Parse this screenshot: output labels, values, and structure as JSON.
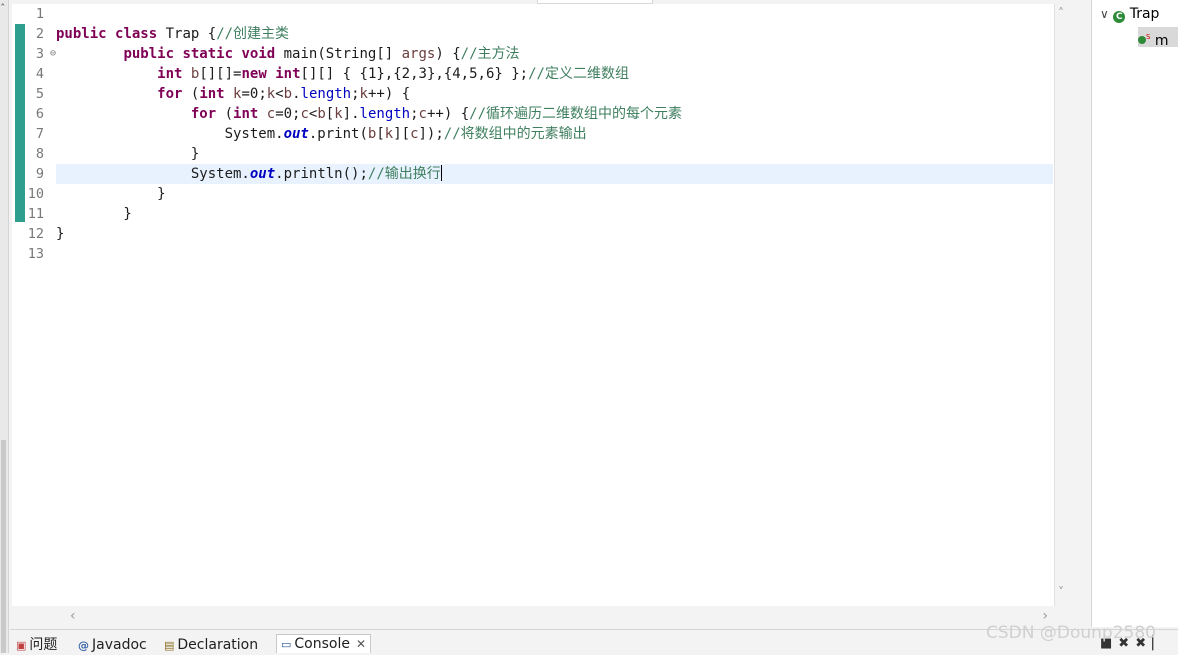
{
  "editor": {
    "lines": [
      {
        "n": "1",
        "parts": []
      },
      {
        "n": "2",
        "parts": [
          [
            "kw",
            "public"
          ],
          [
            "t",
            " "
          ],
          [
            "kw",
            "class"
          ],
          [
            "t",
            " Trap {"
          ],
          [
            "cm",
            "//创建主类"
          ]
        ]
      },
      {
        "n": "3",
        "fold": true,
        "parts": [
          [
            "t",
            "        "
          ],
          [
            "kw",
            "public"
          ],
          [
            "t",
            " "
          ],
          [
            "kw",
            "static"
          ],
          [
            "t",
            " "
          ],
          [
            "kw",
            "void"
          ],
          [
            "t",
            " main(String[] "
          ],
          [
            "lv",
            "args"
          ],
          [
            "t",
            ") {"
          ],
          [
            "cm",
            "//主方法"
          ]
        ]
      },
      {
        "n": "4",
        "parts": [
          [
            "t",
            "            "
          ],
          [
            "kw",
            "int"
          ],
          [
            "t",
            " "
          ],
          [
            "lv",
            "b"
          ],
          [
            "t",
            "[][]="
          ],
          [
            "kw",
            "new"
          ],
          [
            "t",
            " "
          ],
          [
            "kw",
            "int"
          ],
          [
            "t",
            "[][] { {1},{2,3},{4,5,6} };"
          ],
          [
            "cm",
            "//定义二维数组"
          ]
        ]
      },
      {
        "n": "5",
        "parts": [
          [
            "t",
            "            "
          ],
          [
            "kw",
            "for"
          ],
          [
            "t",
            " ("
          ],
          [
            "kw",
            "int"
          ],
          [
            "t",
            " "
          ],
          [
            "lv",
            "k"
          ],
          [
            "t",
            "=0;"
          ],
          [
            "lv",
            "k"
          ],
          [
            "t",
            "<"
          ],
          [
            "lv",
            "b"
          ],
          [
            "t",
            "."
          ],
          [
            "fld",
            "length"
          ],
          [
            "t",
            ";"
          ],
          [
            "lv",
            "k"
          ],
          [
            "t",
            "++) {"
          ]
        ]
      },
      {
        "n": "6",
        "parts": [
          [
            "t",
            "                "
          ],
          [
            "kw",
            "for"
          ],
          [
            "t",
            " ("
          ],
          [
            "kw",
            "int"
          ],
          [
            "t",
            " "
          ],
          [
            "lv",
            "c"
          ],
          [
            "t",
            "=0;"
          ],
          [
            "lv",
            "c"
          ],
          [
            "t",
            "<"
          ],
          [
            "lv",
            "b"
          ],
          [
            "t",
            "["
          ],
          [
            "lv",
            "k"
          ],
          [
            "t",
            "]."
          ],
          [
            "fld",
            "length"
          ],
          [
            "t",
            ";"
          ],
          [
            "lv",
            "c"
          ],
          [
            "t",
            "++) {"
          ],
          [
            "cm",
            "//循环遍历二维数组中的每个元素"
          ]
        ]
      },
      {
        "n": "7",
        "parts": [
          [
            "t",
            "                    System."
          ],
          [
            "sfld",
            "out"
          ],
          [
            "t",
            ".print("
          ],
          [
            "lv",
            "b"
          ],
          [
            "t",
            "["
          ],
          [
            "lv",
            "k"
          ],
          [
            "t",
            "]["
          ],
          [
            "lv",
            "c"
          ],
          [
            "t",
            "]);"
          ],
          [
            "cm",
            "//将数组中的元素输出"
          ]
        ]
      },
      {
        "n": "8",
        "parts": [
          [
            "t",
            "                }"
          ]
        ]
      },
      {
        "n": "9",
        "current": true,
        "caret": true,
        "parts": [
          [
            "t",
            "                System."
          ],
          [
            "sfld",
            "out"
          ],
          [
            "t",
            ".println();"
          ],
          [
            "cm",
            "//输出换行"
          ]
        ]
      },
      {
        "n": "10",
        "parts": [
          [
            "t",
            "            }"
          ]
        ]
      },
      {
        "n": "11",
        "parts": [
          [
            "t",
            "        }"
          ]
        ]
      },
      {
        "n": "12",
        "parts": [
          [
            "t",
            "}"
          ]
        ]
      },
      {
        "n": "13",
        "parts": []
      }
    ]
  },
  "outline": {
    "class_label": "Trap",
    "method_label": "m",
    "class_icon": "class-icon",
    "method_icon": "public-method-icon"
  },
  "bottom_tabs": [
    {
      "label": "问题",
      "icon": "problems-icon",
      "active": false
    },
    {
      "label": "Javadoc",
      "icon": "javadoc-icon",
      "active": false
    },
    {
      "label": "Declaration",
      "icon": "declaration-icon",
      "active": false
    },
    {
      "label": "Console",
      "icon": "console-icon",
      "active": true
    }
  ],
  "watermark": "CSDN @Dounp2580",
  "colors": {
    "keyword": "#7f0055",
    "comment": "#3f7f5f",
    "field": "#0000c0",
    "local_var": "#6a3e3e",
    "current_line": "#e8f2fe",
    "change_marker": "#2e9e8f"
  }
}
